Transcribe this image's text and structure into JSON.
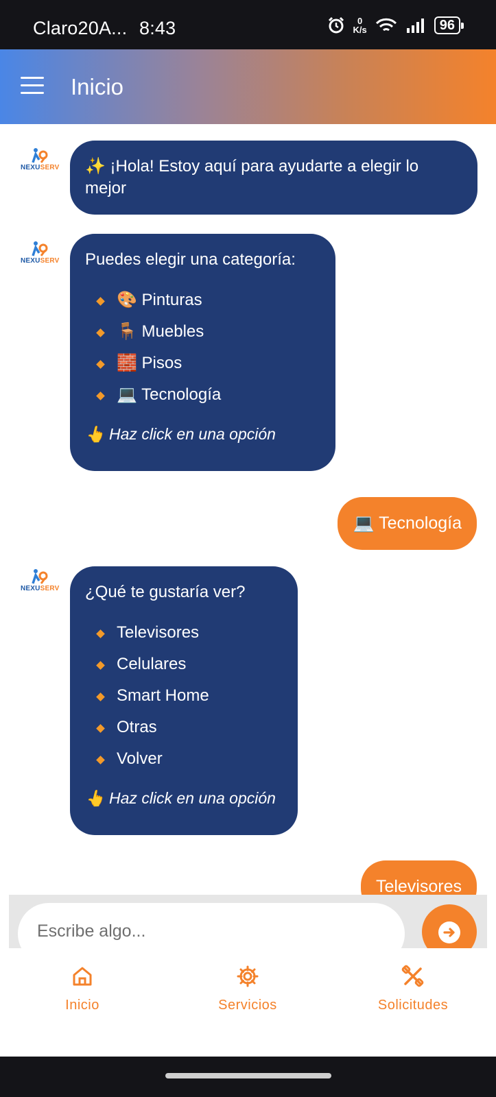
{
  "status_bar": {
    "carrier": "Claro20A...",
    "time": "8:43",
    "net_speed_value": "0",
    "net_speed_unit": "K/s",
    "battery": "96"
  },
  "appbar": {
    "title": "Inicio"
  },
  "chat": {
    "messages": [
      {
        "text": "✨ ¡Hola! Estoy aquí para ayudarte a elegir lo mejor"
      },
      {
        "title": "Puedes elegir una categoría:",
        "options": [
          "🎨 Pinturas",
          "🪑 Muebles",
          "🧱 Pisos",
          "💻 Tecnología"
        ],
        "hint": "👆 Haz click en una opción"
      },
      {
        "text": "💻 Tecnología"
      },
      {
        "title": "¿Qué te gustaría ver?",
        "options": [
          "Televisores",
          "Celulares",
          "Smart Home",
          "Otras",
          "Volver"
        ],
        "hint": "👆 Haz click en una opción"
      },
      {
        "text": "Televisores"
      }
    ],
    "logo_text_a": "NEXU",
    "logo_text_b": "SERV"
  },
  "input": {
    "placeholder": "Escribe algo..."
  },
  "bottom_nav": {
    "items": [
      {
        "label": "Inicio",
        "icon": "home-icon"
      },
      {
        "label": "Servicios",
        "icon": "gear-icon"
      },
      {
        "label": "Solicitudes",
        "icon": "tools-icon"
      }
    ]
  },
  "colors": {
    "bot_bubble": "#213b74",
    "user_bubble": "#f4822b",
    "accent": "#f4822b"
  }
}
